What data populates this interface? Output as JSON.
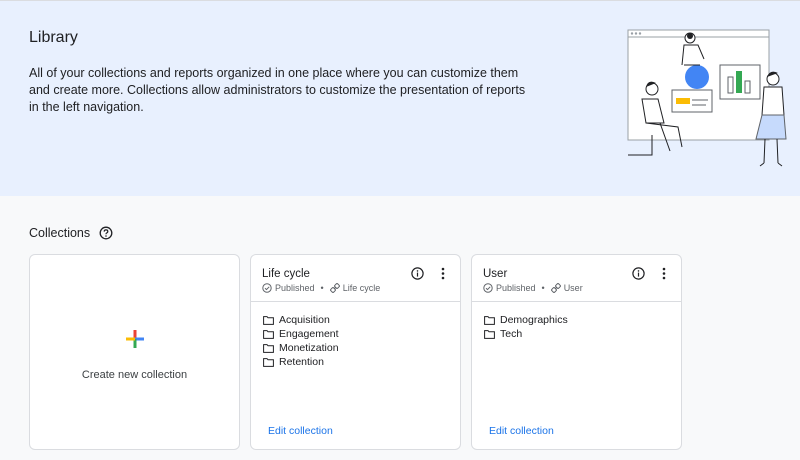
{
  "header": {
    "title": "Library",
    "description": "All of your collections and reports organized in one place where you can customize them and create more. Collections allow administrators to customize the presentation of reports in the left navigation."
  },
  "collections_section": {
    "title": "Collections",
    "help_icon": "help-circle-icon"
  },
  "create_card": {
    "label": "Create new collection",
    "icon": "plus-icon",
    "icon_colors": [
      "#4285f4",
      "#ea4335",
      "#fbbc04",
      "#34a853"
    ]
  },
  "cards": [
    {
      "title": "Life cycle",
      "status": "Published",
      "template": "Life cycle",
      "reports": [
        "Acquisition",
        "Engagement",
        "Monetization",
        "Retention"
      ],
      "edit_label": "Edit collection"
    },
    {
      "title": "User",
      "status": "Published",
      "template": "User",
      "reports": [
        "Demographics",
        "Tech"
      ],
      "edit_label": "Edit collection"
    }
  ],
  "colors": {
    "hero_bg": "#e8f0fe",
    "link": "#1a73e8",
    "text": "#202124",
    "muted": "#5f6368"
  }
}
